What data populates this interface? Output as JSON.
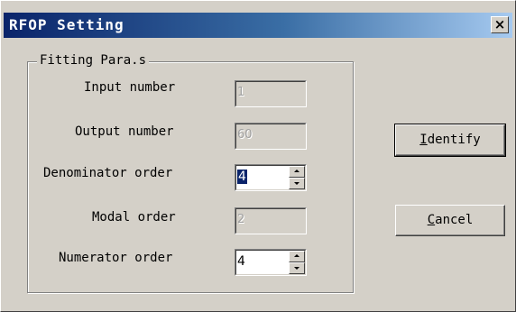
{
  "window": {
    "title": "RFOP Setting",
    "close_symbol": "×"
  },
  "group": {
    "label": "Fitting Para.s"
  },
  "fields": {
    "input_number": {
      "label": "Input number",
      "value": "1",
      "enabled": false
    },
    "output_number": {
      "label": "Output number",
      "value": "60",
      "enabled": false
    },
    "denominator_order": {
      "label": "Denominator order",
      "value": "4",
      "enabled": true,
      "selected": true
    },
    "modal_order": {
      "label": "Modal order",
      "value": "2",
      "enabled": false
    },
    "numerator_order": {
      "label": "Numerator order",
      "value": "4",
      "enabled": true
    }
  },
  "buttons": {
    "identify": {
      "mnemonic": "I",
      "rest": "dentify"
    },
    "cancel": {
      "mnemonic": "C",
      "rest": "ancel"
    }
  },
  "icons": {
    "close": "close-icon",
    "spin_up": "arrow-up-icon",
    "spin_down": "arrow-down-icon"
  },
  "colors": {
    "face": "#d4d0c8",
    "title_start": "#0a246a",
    "title_end": "#a6caf0",
    "selection": "#0a246a"
  }
}
